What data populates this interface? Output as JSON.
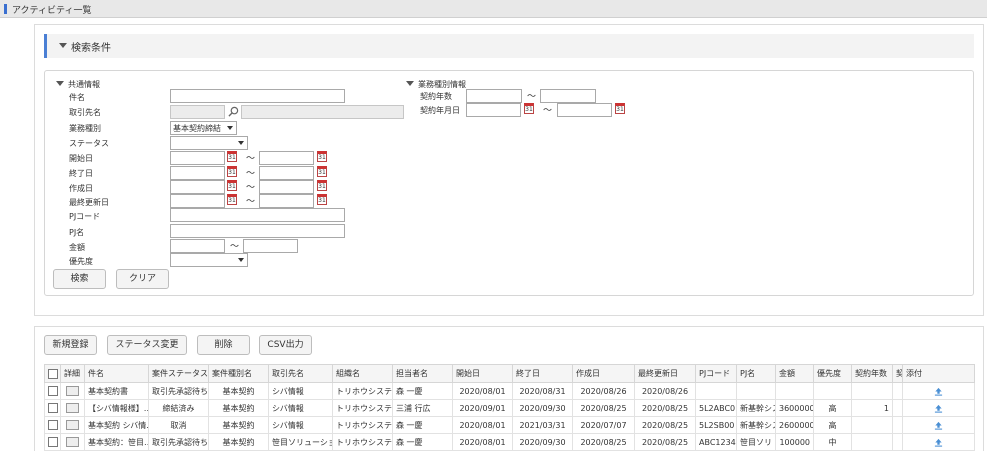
{
  "title": "アクティビティ一覧",
  "search": {
    "header": "検索条件",
    "common_group": "共通情報",
    "business_group": "業務種別情報",
    "labels": {
      "name": "件名",
      "client": "取引先名",
      "business_type": "業務種別",
      "status": "ステータス",
      "start_date": "開始日",
      "end_date": "終了日",
      "created_date": "作成日",
      "updated_date": "最終更新日",
      "pj_code": "PJコード",
      "pj_name": "PJ名",
      "amount": "金額",
      "priority": "優先度",
      "contract_years": "契約年数",
      "contract_date": "契約年月日"
    },
    "business_type_value": "基本契約締結",
    "tilde": "～",
    "cal_label": "31",
    "search_button": "検索",
    "clear_button": "クリア"
  },
  "toolbar": {
    "new": "新規登録",
    "status_change": "ステータス変更",
    "delete": "削除",
    "csv": "CSV出力"
  },
  "table": {
    "headers": [
      "",
      "詳細",
      "件名",
      "案件ステータス",
      "案件種別名",
      "取引先名",
      "組織名",
      "担当者名",
      "開始日",
      "終了日",
      "作成日",
      "最終更新日",
      "PJコード",
      "PJ名",
      "金額",
      "優先度",
      "契約年数",
      "契",
      "添付"
    ],
    "rows": [
      [
        "基本契約書",
        "取引先承認待ち",
        "基本契約",
        "シバ情報",
        "トリホウシステム",
        "森 一慶",
        "2020/08/01",
        "2020/08/31",
        "2020/08/26",
        "2020/08/26",
        "",
        "",
        "",
        "",
        "",
        ""
      ],
      [
        "【シバ情報様】…",
        "締結済み",
        "基本契約",
        "シバ情報",
        "トリホウシステム",
        "三浦 行広",
        "2020/09/01",
        "2020/09/30",
        "2020/08/25",
        "2020/08/25",
        "5L2ABC0",
        "新基幹シス",
        "3600000",
        "高",
        "1",
        ""
      ],
      [
        "基本契約 シバ情…",
        "取消",
        "基本契約",
        "シバ情報",
        "トリホウシステム",
        "森 一慶",
        "2020/08/01",
        "2021/03/31",
        "2020/07/07",
        "2020/08/25",
        "5L2SB00",
        "新基幹シス",
        "2600000",
        "高",
        "",
        ""
      ],
      [
        "基本契約：笹目…",
        "取引先承認待ち",
        "基本契約",
        "笹目ソリューション",
        "トリホウシステム",
        "森 一慶",
        "2020/08/01",
        "2020/09/30",
        "2020/08/25",
        "2020/08/25",
        "ABC1234",
        "笹目ソリ",
        "100000",
        "中",
        "",
        ""
      ]
    ]
  }
}
